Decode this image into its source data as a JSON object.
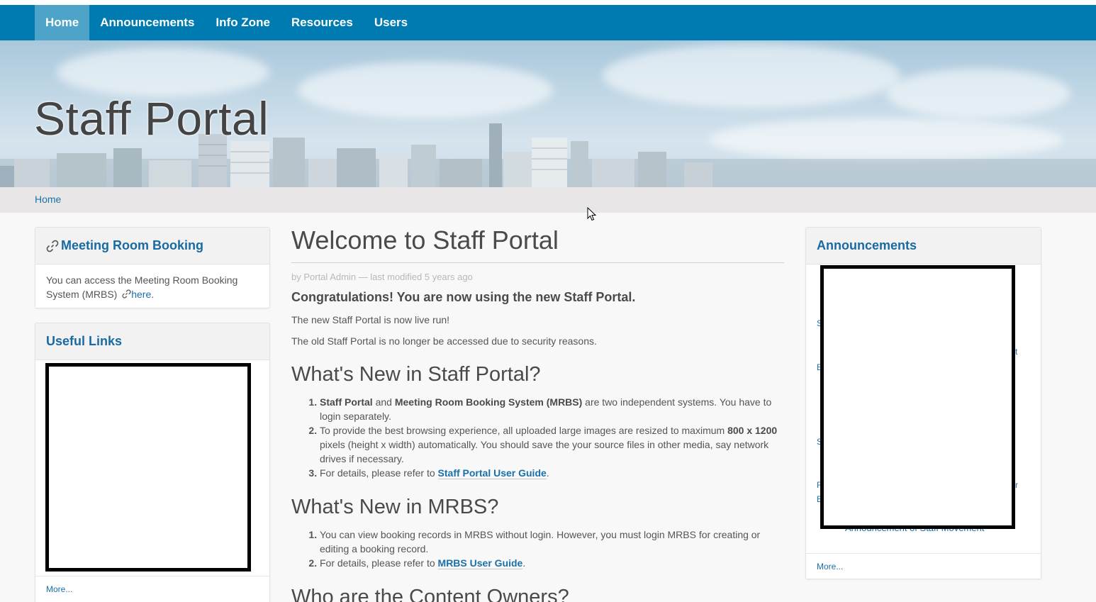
{
  "nav": {
    "items": [
      {
        "label": "Home",
        "active": true
      },
      {
        "label": "Announcements"
      },
      {
        "label": "Info Zone"
      },
      {
        "label": "Resources"
      },
      {
        "label": "Users"
      }
    ]
  },
  "banner": {
    "title": "Staff Portal"
  },
  "breadcrumb": {
    "home": "Home"
  },
  "left": {
    "booking": {
      "header": "Meeting Room Booking",
      "text": "You can access the Meeting Room Booking System (MRBS)",
      "link": "here",
      "period": "."
    },
    "useful_links": {
      "header": "Useful Links",
      "more": "More..."
    }
  },
  "main": {
    "title": "Welcome to Staff Portal",
    "byline": "by Portal Admin — last modified 5 years ago",
    "lead": "Congratulations! You are now using the new Staff Portal.",
    "para1": "The new Staff Portal is now live run!",
    "para2": "The old Staff Portal is no longer be accessed due to security reasons.",
    "h_new_portal": "What's New in Staff Portal?",
    "portal_items": {
      "i1_b1": "Staff Portal",
      "i1_t1": " and ",
      "i1_b2": "Meeting Room Booking System (MRBS)",
      "i1_t2": " are two independent systems. You have to login separately.",
      "i2_t1": "To provide the best browsing experience, all uploaded large images are resized to maximum ",
      "i2_b1": "800 x 1200",
      "i2_t2": " pixels (height x width) automatically. You should save the your source files in other media, say network drives if necessary.",
      "i3_t1": "For details, please refer to ",
      "i3_link": "Staff Portal User Guide",
      "i3_t2": "."
    },
    "h_new_mrbs": "What's New in MRBS?",
    "mrbs_items": {
      "i1": "You can view booking records in MRBS without login. However, you must login MRBS for creating or editing a booking record.",
      "i2_t1": "For details, please refer to ",
      "i2_link": "MRBS User Guide",
      "i2_t2": "."
    },
    "h_owners": "Who are the Content Owners?"
  },
  "right": {
    "announcements": {
      "header": "Announcements",
      "peek_bottom": "Announcement of Staff Movement",
      "more": "More..."
    }
  },
  "colors": {
    "nav_bg": "#007bb1",
    "link": "#1a70a8",
    "breadcrumb_bg": "#e8e6e6"
  }
}
